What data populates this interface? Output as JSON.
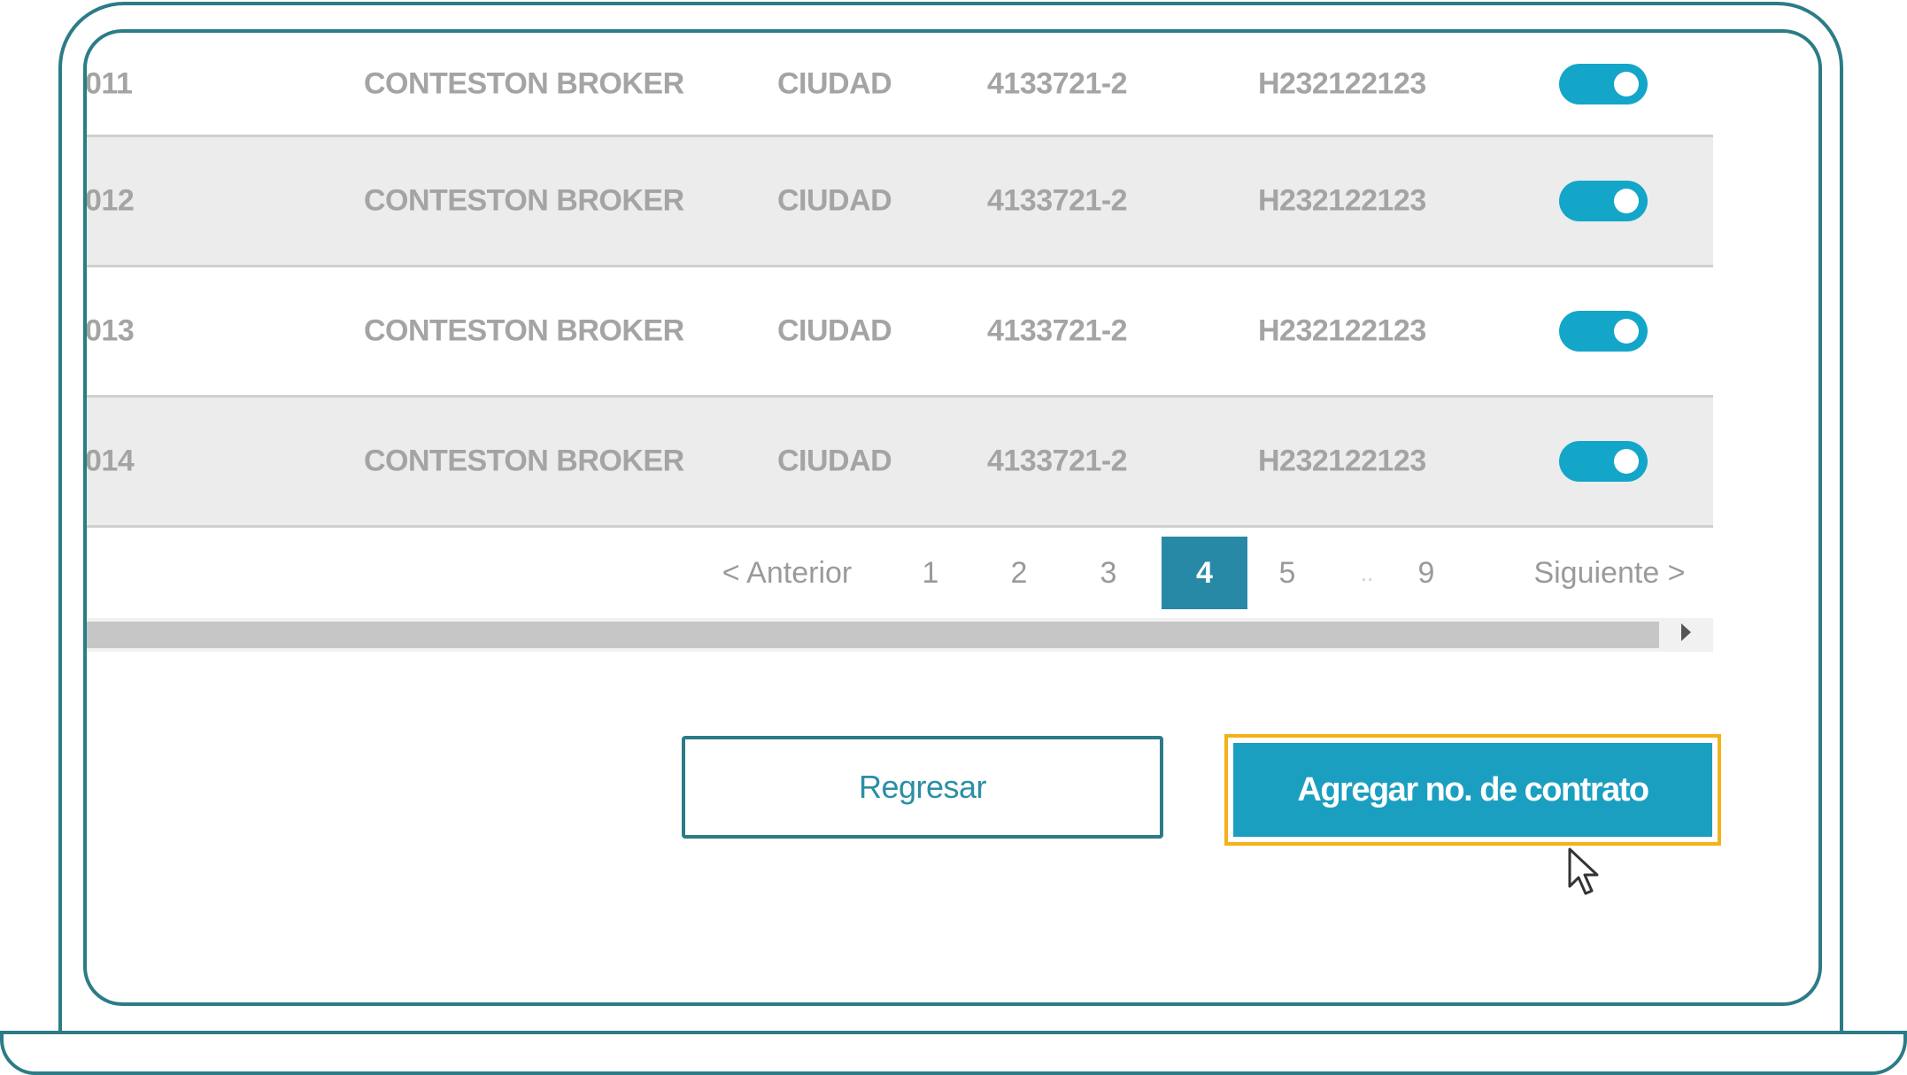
{
  "table": {
    "rows": [
      {
        "id": "011",
        "name": "CONTESTON BROKER",
        "city": "CIUDAD",
        "number": "4133721-2",
        "code": "H232122123",
        "enabled": true
      },
      {
        "id": "012",
        "name": "CONTESTON BROKER",
        "city": "CIUDAD",
        "number": "4133721-2",
        "code": "H232122123",
        "enabled": true
      },
      {
        "id": "013",
        "name": "CONTESTON BROKER",
        "city": "CIUDAD",
        "number": "4133721-2",
        "code": "H232122123",
        "enabled": true
      },
      {
        "id": "014",
        "name": "CONTESTON BROKER",
        "city": "CIUDAD",
        "number": "4133721-2",
        "code": "H232122123",
        "enabled": true
      }
    ]
  },
  "pagination": {
    "prev_label": "< Anterior",
    "pages": [
      "1",
      "2",
      "3",
      "4",
      "5"
    ],
    "ellipsis": "..",
    "last_page": "9",
    "current_page": "4",
    "next_label": "Siguiente >"
  },
  "actions": {
    "back_label": "Regresar",
    "add_label": "Agregar no. de contrato"
  },
  "colors": {
    "accent": "#1b9fc0",
    "frame": "#2b7c86",
    "highlight": "#f4b11a",
    "toggle_on": "#13a6c9"
  },
  "icons": {
    "toggle": "toggle-switch-icon",
    "scroll_right": "triangle-right-icon",
    "cursor": "mouse-pointer-icon"
  }
}
